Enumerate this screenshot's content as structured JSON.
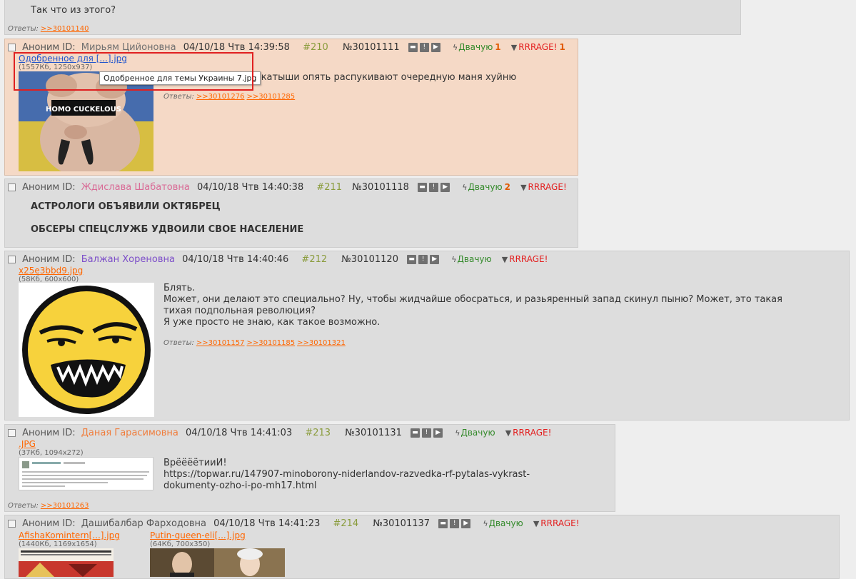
{
  "top_post": {
    "text": "Так что из этого?",
    "replies_label": "Ответы:",
    "replies": [
      ">>30101140"
    ]
  },
  "common": {
    "anon_label": "Аноним ID:",
    "like_label": "Двачую",
    "dislike_label": "RRRAGE!",
    "replies_label": "Ответы:"
  },
  "posts": [
    {
      "name": "Мирьям  Цийоновна",
      "name_color": "#707070",
      "datetime": "04/10/18 Чтв 14:39:58",
      "index": "#210",
      "number": "№30101111",
      "likes": "1",
      "dislikes": "1",
      "file_name": "Одобренное для [...].jpg",
      "file_info": "(1557Кб, 1250x937)",
      "tooltip": "Одобренное для темы Украины 7.jpg",
      "image_caption": "HOMO CUCKELOUS",
      "text": "нрокатыши опять распукивают очередную маня хуйню",
      "replies": [
        ">>30101276",
        ">>30101285"
      ]
    },
    {
      "name": "Ждислава Шабатовна",
      "name_color": "#d96b96",
      "datetime": "04/10/18 Чтв 14:40:38",
      "index": "#211",
      "number": "№30101118",
      "likes": "2",
      "lines": [
        "АСТРОЛОГИ ОБЪЯВИЛИ ОКТЯБРЕЦ",
        "ОБСЕРЫ СПЕЦСЛУЖБ УДВОИЛИ СВОЕ НАСЕЛЕНИЕ"
      ]
    },
    {
      "name": "Балжан Хореновна",
      "name_color": "#7d4fc9",
      "datetime": "04/10/18 Чтв 14:40:46",
      "index": "#212",
      "number": "№30101120",
      "file_name": "x25e3bbd9.jpg",
      "file_info": "(58Кб, 600x600)",
      "lines": [
        "Блять.",
        "Может, они делают это специально? Ну, чтобы жидчайше обосраться, и разьяренный запад скинул пыню? Может, это такая",
        "тихая подпольная революция?",
        "Я уже просто не знаю, как такое возможно."
      ],
      "replies": [
        ">>30101157",
        ">>30101185",
        ">>30101321"
      ]
    },
    {
      "name": "Даная Гарасимовна",
      "name_color": "#f07d3c",
      "datetime": "04/10/18 Чтв 14:41:03",
      "index": "#213",
      "number": "№30101131",
      "file_name": ".JPG",
      "file_info": "(37Кб, 1094x272)",
      "lines": [
        "ВрёёёётииИ!",
        "https://topwar.ru/147907-minoborony-niderlandov-razvedka-rf-pytalas-vykrast-",
        "dokumenty-ozho-i-po-mh17.html"
      ],
      "replies": [
        ">>30101263"
      ]
    },
    {
      "name": "Дашибалбар Фарходовна",
      "name_color": "#555555",
      "datetime": "04/10/18 Чтв 14:41:23",
      "index": "#214",
      "number": "№30101137",
      "files": [
        {
          "name": "AfishaKomintern[...].jpg",
          "info": "(1440Кб, 1169x1654)"
        },
        {
          "name": "Putin-queen-eli[...].jpg",
          "info": "(64Кб, 700x350)"
        }
      ]
    }
  ]
}
